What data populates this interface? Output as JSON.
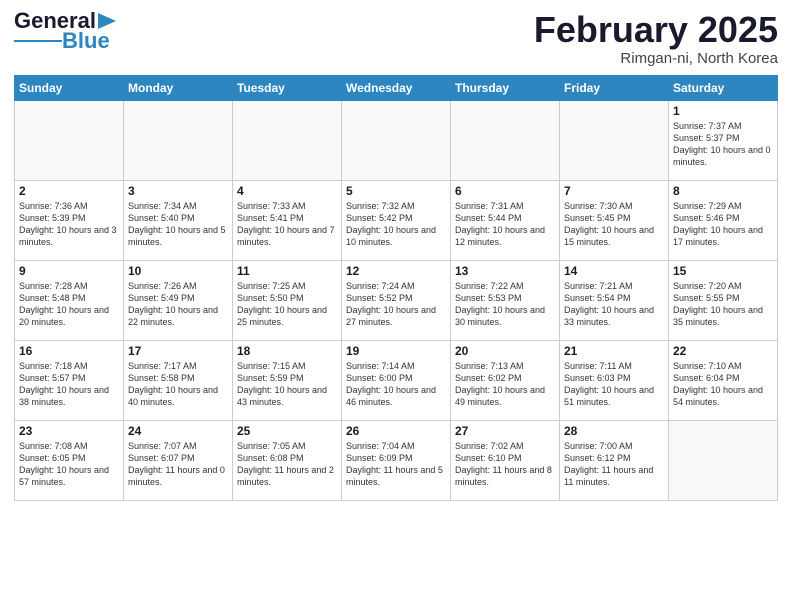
{
  "header": {
    "logo_general": "General",
    "logo_blue": "Blue",
    "month_title": "February 2025",
    "location": "Rimgan-ni, North Korea"
  },
  "days_of_week": [
    "Sunday",
    "Monday",
    "Tuesday",
    "Wednesday",
    "Thursday",
    "Friday",
    "Saturday"
  ],
  "weeks": [
    [
      {
        "day": "",
        "info": ""
      },
      {
        "day": "",
        "info": ""
      },
      {
        "day": "",
        "info": ""
      },
      {
        "day": "",
        "info": ""
      },
      {
        "day": "",
        "info": ""
      },
      {
        "day": "",
        "info": ""
      },
      {
        "day": "1",
        "info": "Sunrise: 7:37 AM\nSunset: 5:37 PM\nDaylight: 10 hours\nand 0 minutes."
      }
    ],
    [
      {
        "day": "2",
        "info": "Sunrise: 7:36 AM\nSunset: 5:39 PM\nDaylight: 10 hours\nand 3 minutes."
      },
      {
        "day": "3",
        "info": "Sunrise: 7:34 AM\nSunset: 5:40 PM\nDaylight: 10 hours\nand 5 minutes."
      },
      {
        "day": "4",
        "info": "Sunrise: 7:33 AM\nSunset: 5:41 PM\nDaylight: 10 hours\nand 7 minutes."
      },
      {
        "day": "5",
        "info": "Sunrise: 7:32 AM\nSunset: 5:42 PM\nDaylight: 10 hours\nand 10 minutes."
      },
      {
        "day": "6",
        "info": "Sunrise: 7:31 AM\nSunset: 5:44 PM\nDaylight: 10 hours\nand 12 minutes."
      },
      {
        "day": "7",
        "info": "Sunrise: 7:30 AM\nSunset: 5:45 PM\nDaylight: 10 hours\nand 15 minutes."
      },
      {
        "day": "8",
        "info": "Sunrise: 7:29 AM\nSunset: 5:46 PM\nDaylight: 10 hours\nand 17 minutes."
      }
    ],
    [
      {
        "day": "9",
        "info": "Sunrise: 7:28 AM\nSunset: 5:48 PM\nDaylight: 10 hours\nand 20 minutes."
      },
      {
        "day": "10",
        "info": "Sunrise: 7:26 AM\nSunset: 5:49 PM\nDaylight: 10 hours\nand 22 minutes."
      },
      {
        "day": "11",
        "info": "Sunrise: 7:25 AM\nSunset: 5:50 PM\nDaylight: 10 hours\nand 25 minutes."
      },
      {
        "day": "12",
        "info": "Sunrise: 7:24 AM\nSunset: 5:52 PM\nDaylight: 10 hours\nand 27 minutes."
      },
      {
        "day": "13",
        "info": "Sunrise: 7:22 AM\nSunset: 5:53 PM\nDaylight: 10 hours\nand 30 minutes."
      },
      {
        "day": "14",
        "info": "Sunrise: 7:21 AM\nSunset: 5:54 PM\nDaylight: 10 hours\nand 33 minutes."
      },
      {
        "day": "15",
        "info": "Sunrise: 7:20 AM\nSunset: 5:55 PM\nDaylight: 10 hours\nand 35 minutes."
      }
    ],
    [
      {
        "day": "16",
        "info": "Sunrise: 7:18 AM\nSunset: 5:57 PM\nDaylight: 10 hours\nand 38 minutes."
      },
      {
        "day": "17",
        "info": "Sunrise: 7:17 AM\nSunset: 5:58 PM\nDaylight: 10 hours\nand 40 minutes."
      },
      {
        "day": "18",
        "info": "Sunrise: 7:15 AM\nSunset: 5:59 PM\nDaylight: 10 hours\nand 43 minutes."
      },
      {
        "day": "19",
        "info": "Sunrise: 7:14 AM\nSunset: 6:00 PM\nDaylight: 10 hours\nand 46 minutes."
      },
      {
        "day": "20",
        "info": "Sunrise: 7:13 AM\nSunset: 6:02 PM\nDaylight: 10 hours\nand 49 minutes."
      },
      {
        "day": "21",
        "info": "Sunrise: 7:11 AM\nSunset: 6:03 PM\nDaylight: 10 hours\nand 51 minutes."
      },
      {
        "day": "22",
        "info": "Sunrise: 7:10 AM\nSunset: 6:04 PM\nDaylight: 10 hours\nand 54 minutes."
      }
    ],
    [
      {
        "day": "23",
        "info": "Sunrise: 7:08 AM\nSunset: 6:05 PM\nDaylight: 10 hours\nand 57 minutes."
      },
      {
        "day": "24",
        "info": "Sunrise: 7:07 AM\nSunset: 6:07 PM\nDaylight: 11 hours\nand 0 minutes."
      },
      {
        "day": "25",
        "info": "Sunrise: 7:05 AM\nSunset: 6:08 PM\nDaylight: 11 hours\nand 2 minutes."
      },
      {
        "day": "26",
        "info": "Sunrise: 7:04 AM\nSunset: 6:09 PM\nDaylight: 11 hours\nand 5 minutes."
      },
      {
        "day": "27",
        "info": "Sunrise: 7:02 AM\nSunset: 6:10 PM\nDaylight: 11 hours\nand 8 minutes."
      },
      {
        "day": "28",
        "info": "Sunrise: 7:00 AM\nSunset: 6:12 PM\nDaylight: 11 hours\nand 11 minutes."
      },
      {
        "day": "",
        "info": ""
      }
    ]
  ]
}
